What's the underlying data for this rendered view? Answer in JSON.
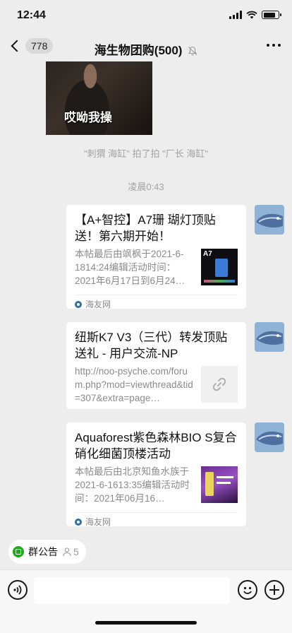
{
  "status": {
    "time": "12:44",
    "battery_level": 0.85
  },
  "nav": {
    "unread_count": "778",
    "title": "海生物团购(500)",
    "back_icon": "chevron-left-icon",
    "mute_icon": "bell-off-icon",
    "more_icon": "more-dots-icon"
  },
  "chat": {
    "meme_caption": "哎呦我操",
    "pat_message": "\"刺猬 海缸\" 拍了拍 \"厂长 海缸\"",
    "timestamp": "凌晨0:43",
    "cards": [
      {
        "title": "【A+智控】A7珊 瑚灯顶贴送！第六期开始！",
        "desc": "本帖最后由飒枫于2021-6-1814:24编辑活动时间：2021年6月17日到6月24…",
        "thumb_text": "A7",
        "source": "海友网"
      },
      {
        "title": "纽斯K7 V3（三代）转发顶贴送礼 - 用户交流-NP",
        "desc": "http://noo-psyche.com/forum.php?mod=viewthread&tid=307&extra=page…",
        "thumb_icon": "link-icon"
      },
      {
        "title": "Aquaforest紫色森林BIO S复合硝化细菌顶楼活动",
        "desc": "本帖最后由北京知鱼水族于2021-6-1613:35编辑活动时间：2021年06月16…",
        "source": "海友网"
      }
    ]
  },
  "bottom": {
    "announcement_label": "群公告",
    "member_count": "5"
  },
  "colors": {
    "background": "#ededed",
    "card": "#ffffff",
    "accent_green": "#1aad19"
  }
}
